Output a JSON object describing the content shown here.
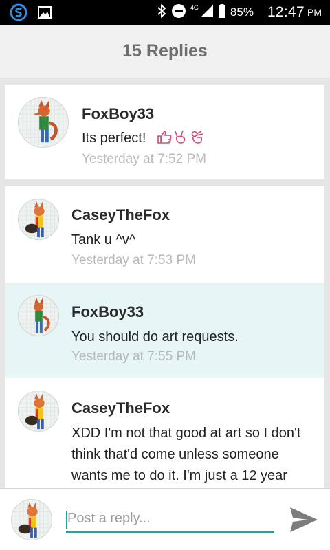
{
  "status_bar": {
    "network": "4G",
    "battery": "85%",
    "time": "12:47",
    "ampm": "PM"
  },
  "header": {
    "title": "15 Replies"
  },
  "replies": [
    {
      "user": "FoxBoy33",
      "text": "Its perfect!",
      "time": "Yesterday at 7:52 PM",
      "emoji_icons": [
        "thumbs-up-icon",
        "victory-hand-icon",
        "ok-hand-icon"
      ]
    },
    {
      "user": "CaseyTheFox",
      "text": "Tank u ^v^",
      "time": "Yesterday at 7:53 PM"
    },
    {
      "user": "FoxBoy33",
      "text": "You should do art requests.",
      "time": "Yesterday at 7:55 PM",
      "highlighted": true
    },
    {
      "user": "CaseyTheFox",
      "text_lines": [
        "XDD I'm not that good at art so I don't",
        "think that'd come unless someone",
        "wants me to do it. I'm just a 12 year"
      ]
    }
  ],
  "reply_bar": {
    "placeholder": "Post a reply..."
  },
  "colors": {
    "accent": "#1ba4a1",
    "highlight_bg": "#e6f5f5",
    "timestamp": "#b9b9b9",
    "header_text": "#6e6e6e"
  }
}
